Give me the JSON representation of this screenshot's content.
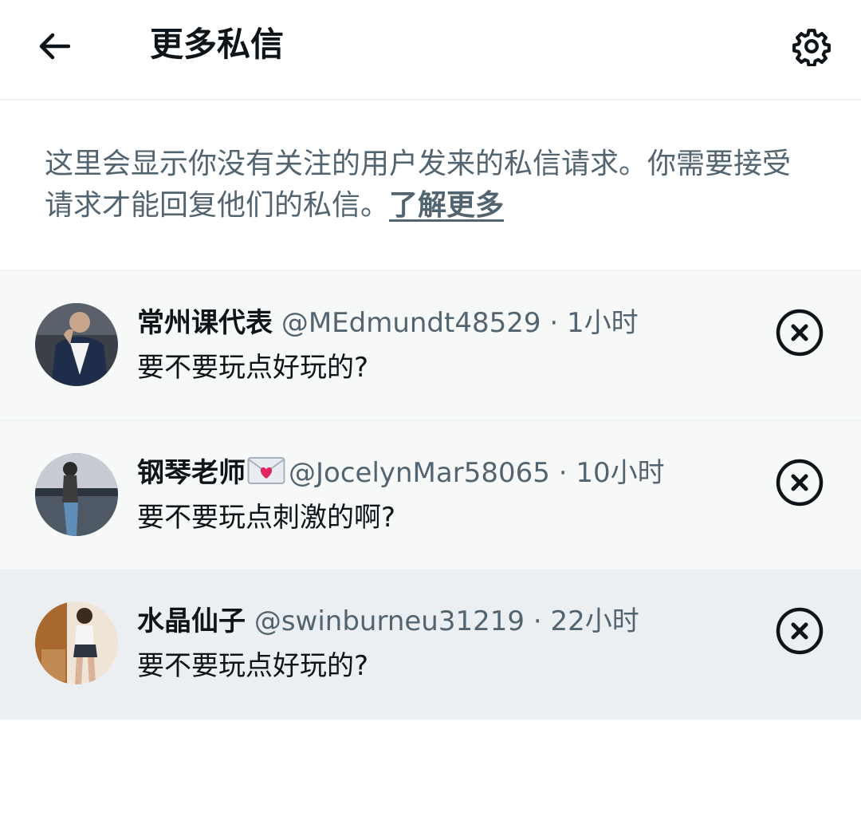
{
  "header": {
    "title": "更多私信",
    "back_icon": "arrow-left-icon",
    "settings_icon": "gear-icon"
  },
  "notice": {
    "text": "这里会显示你没有关注的用户发来的私信请求。你需要接受请求才能回复他们的私信。",
    "link_label": "了解更多"
  },
  "requests": [
    {
      "name": "常州课代表",
      "handle": "@MEdmundt48529",
      "separator": "·",
      "time": "1小时",
      "message": "要不要玩点好玩的?",
      "dismiss_icon": "close-circle-icon"
    },
    {
      "name": "钢琴老师",
      "name_icon": "love-letter-icon",
      "handle": "@JocelynMar58065",
      "separator": "·",
      "time": "10小时",
      "message": "要不要玩点刺激的啊?",
      "dismiss_icon": "close-circle-icon"
    },
    {
      "name": "水晶仙子",
      "handle": "@swinburneu31219",
      "separator": "·",
      "time": "22小时",
      "message": "要不要玩点好玩的?",
      "dismiss_icon": "close-circle-icon"
    }
  ],
  "colors": {
    "text_primary": "#0f1419",
    "text_secondary": "#536471",
    "row_background": "#f7f9f9",
    "row_background_active": "#eceff1",
    "divider": "#eff3f4"
  }
}
